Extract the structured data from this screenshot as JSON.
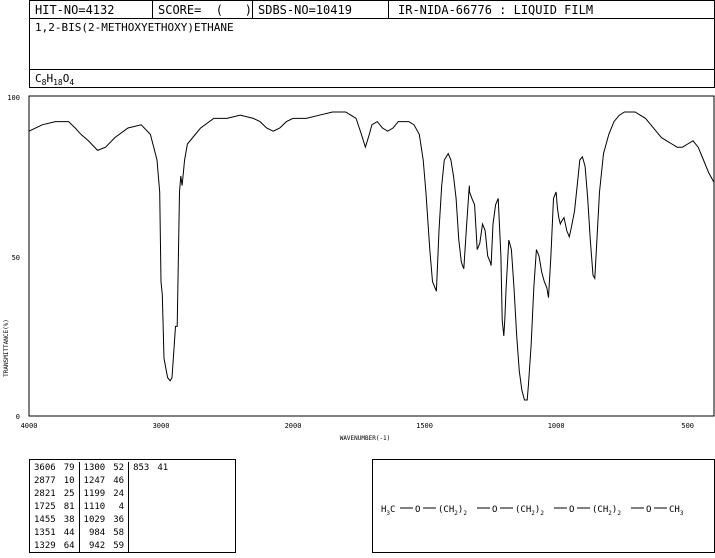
{
  "header": {
    "hit_no": "HIT-NO=4132",
    "score": "SCORE=  (   )",
    "sdbs_no": "SDBS-NO=10419",
    "ir_method": "IR-NIDA-66776 : LIQUID FILM"
  },
  "compound_name": "1,2-BIS(2-METHOXYETHOXY)ETHANE",
  "formula": {
    "c": "C",
    "c_n": "8",
    "h": "H",
    "h_n": "18",
    "o": "O",
    "o_n": "4"
  },
  "peaks": [
    [
      {
        "wn": "3606",
        "t": "79"
      },
      {
        "wn": "2877",
        "t": "10"
      },
      {
        "wn": "2821",
        "t": "25"
      },
      {
        "wn": "1725",
        "t": "81"
      },
      {
        "wn": "1455",
        "t": "38"
      },
      {
        "wn": "1351",
        "t": "44"
      },
      {
        "wn": "1329",
        "t": "64"
      }
    ],
    [
      {
        "wn": "1300",
        "t": "52"
      },
      {
        "wn": "1247",
        "t": "46"
      },
      {
        "wn": "1199",
        "t": "24"
      },
      {
        "wn": "1110",
        "t": "4"
      },
      {
        "wn": "1029",
        "t": "36"
      },
      {
        "wn": "984",
        "t": "58"
      },
      {
        "wn": "942",
        "t": "59"
      }
    ],
    [
      {
        "wn": "853",
        "t": "41"
      }
    ]
  ],
  "structure": {
    "h3c": "H3C",
    "o": "O",
    "ch2": "(CH2)2",
    "ch3": "CH3"
  },
  "chart_data": {
    "type": "line",
    "xlabel": "WAVENUMBER(-1)",
    "ylabel": "TRANSMITTANCE(%)",
    "xlim": [
      4000,
      400
    ],
    "ylim": [
      0,
      100
    ],
    "x_ticks": [
      "4000",
      "3000",
      "2000",
      "1500",
      "1000",
      "500"
    ],
    "y_ticks": [
      "0",
      "50",
      "100"
    ],
    "grid": false,
    "series": [
      {
        "points": [
          [
            4000,
            89
          ],
          [
            3900,
            91
          ],
          [
            3800,
            92
          ],
          [
            3700,
            92
          ],
          [
            3650,
            90
          ],
          [
            3606,
            88
          ],
          [
            3550,
            86
          ],
          [
            3480,
            83
          ],
          [
            3420,
            84
          ],
          [
            3350,
            87
          ],
          [
            3250,
            90
          ],
          [
            3150,
            91
          ],
          [
            3080,
            88
          ],
          [
            3030,
            80
          ],
          [
            3010,
            70
          ],
          [
            3000,
            42
          ],
          [
            2990,
            38
          ],
          [
            2977,
            18
          ],
          [
            2950,
            12
          ],
          [
            2930,
            11
          ],
          [
            2917,
            12
          ],
          [
            2900,
            22
          ],
          [
            2890,
            28
          ],
          [
            2877,
            28
          ],
          [
            2860,
            70
          ],
          [
            2850,
            75
          ],
          [
            2840,
            72
          ],
          [
            2821,
            80
          ],
          [
            2800,
            85
          ],
          [
            2700,
            90
          ],
          [
            2600,
            93
          ],
          [
            2500,
            93
          ],
          [
            2400,
            94
          ],
          [
            2300,
            93
          ],
          [
            2250,
            92
          ],
          [
            2200,
            90
          ],
          [
            2150,
            89
          ],
          [
            2100,
            90
          ],
          [
            2050,
            92
          ],
          [
            2000,
            93
          ],
          [
            1950,
            93
          ],
          [
            1900,
            94
          ],
          [
            1850,
            95
          ],
          [
            1800,
            95
          ],
          [
            1780,
            94
          ],
          [
            1760,
            93
          ],
          [
            1740,
            88
          ],
          [
            1725,
            84
          ],
          [
            1710,
            88
          ],
          [
            1700,
            91
          ],
          [
            1680,
            92
          ],
          [
            1660,
            90
          ],
          [
            1640,
            89
          ],
          [
            1620,
            90
          ],
          [
            1600,
            92
          ],
          [
            1580,
            92
          ],
          [
            1560,
            92
          ],
          [
            1540,
            91
          ],
          [
            1520,
            88
          ],
          [
            1505,
            80
          ],
          [
            1495,
            70
          ],
          [
            1480,
            52
          ],
          [
            1470,
            42
          ],
          [
            1460,
            40
          ],
          [
            1455,
            39
          ],
          [
            1445,
            58
          ],
          [
            1435,
            72
          ],
          [
            1425,
            80
          ],
          [
            1410,
            82
          ],
          [
            1400,
            80
          ],
          [
            1390,
            75
          ],
          [
            1380,
            68
          ],
          [
            1370,
            55
          ],
          [
            1360,
            48
          ],
          [
            1351,
            46
          ],
          [
            1340,
            60
          ],
          [
            1330,
            72
          ],
          [
            1329,
            70
          ],
          [
            1320,
            68
          ],
          [
            1310,
            66
          ],
          [
            1300,
            52
          ],
          [
            1290,
            54
          ],
          [
            1280,
            60
          ],
          [
            1270,
            58
          ],
          [
            1260,
            50
          ],
          [
            1250,
            48
          ],
          [
            1247,
            47
          ],
          [
            1240,
            60
          ],
          [
            1230,
            66
          ],
          [
            1220,
            68
          ],
          [
            1210,
            50
          ],
          [
            1205,
            30
          ],
          [
            1199,
            25
          ],
          [
            1195,
            30
          ],
          [
            1190,
            40
          ],
          [
            1180,
            55
          ],
          [
            1170,
            52
          ],
          [
            1160,
            40
          ],
          [
            1150,
            25
          ],
          [
            1140,
            14
          ],
          [
            1130,
            8
          ],
          [
            1120,
            5
          ],
          [
            1110,
            5
          ],
          [
            1105,
            10
          ],
          [
            1095,
            22
          ],
          [
            1085,
            40
          ],
          [
            1075,
            52
          ],
          [
            1065,
            50
          ],
          [
            1055,
            45
          ],
          [
            1045,
            42
          ],
          [
            1035,
            40
          ],
          [
            1029,
            37
          ],
          [
            1020,
            50
          ],
          [
            1010,
            68
          ],
          [
            1000,
            70
          ],
          [
            995,
            65
          ],
          [
            990,
            62
          ],
          [
            984,
            60
          ],
          [
            978,
            61
          ],
          [
            970,
            62
          ],
          [
            960,
            58
          ],
          [
            950,
            56
          ],
          [
            942,
            59
          ],
          [
            930,
            64
          ],
          [
            920,
            72
          ],
          [
            910,
            80
          ],
          [
            900,
            81
          ],
          [
            890,
            78
          ],
          [
            880,
            68
          ],
          [
            870,
            55
          ],
          [
            860,
            44
          ],
          [
            853,
            43
          ],
          [
            845,
            55
          ],
          [
            835,
            70
          ],
          [
            820,
            82
          ],
          [
            800,
            88
          ],
          [
            780,
            92
          ],
          [
            760,
            94
          ],
          [
            740,
            95
          ],
          [
            720,
            95
          ],
          [
            700,
            95
          ],
          [
            680,
            94
          ],
          [
            660,
            93
          ],
          [
            640,
            91
          ],
          [
            620,
            89
          ],
          [
            600,
            87
          ],
          [
            580,
            86
          ],
          [
            560,
            85
          ],
          [
            540,
            84
          ],
          [
            520,
            84
          ],
          [
            500,
            85
          ],
          [
            480,
            86
          ],
          [
            460,
            84
          ],
          [
            440,
            80
          ],
          [
            420,
            76
          ],
          [
            400,
            73
          ]
        ]
      }
    ]
  }
}
